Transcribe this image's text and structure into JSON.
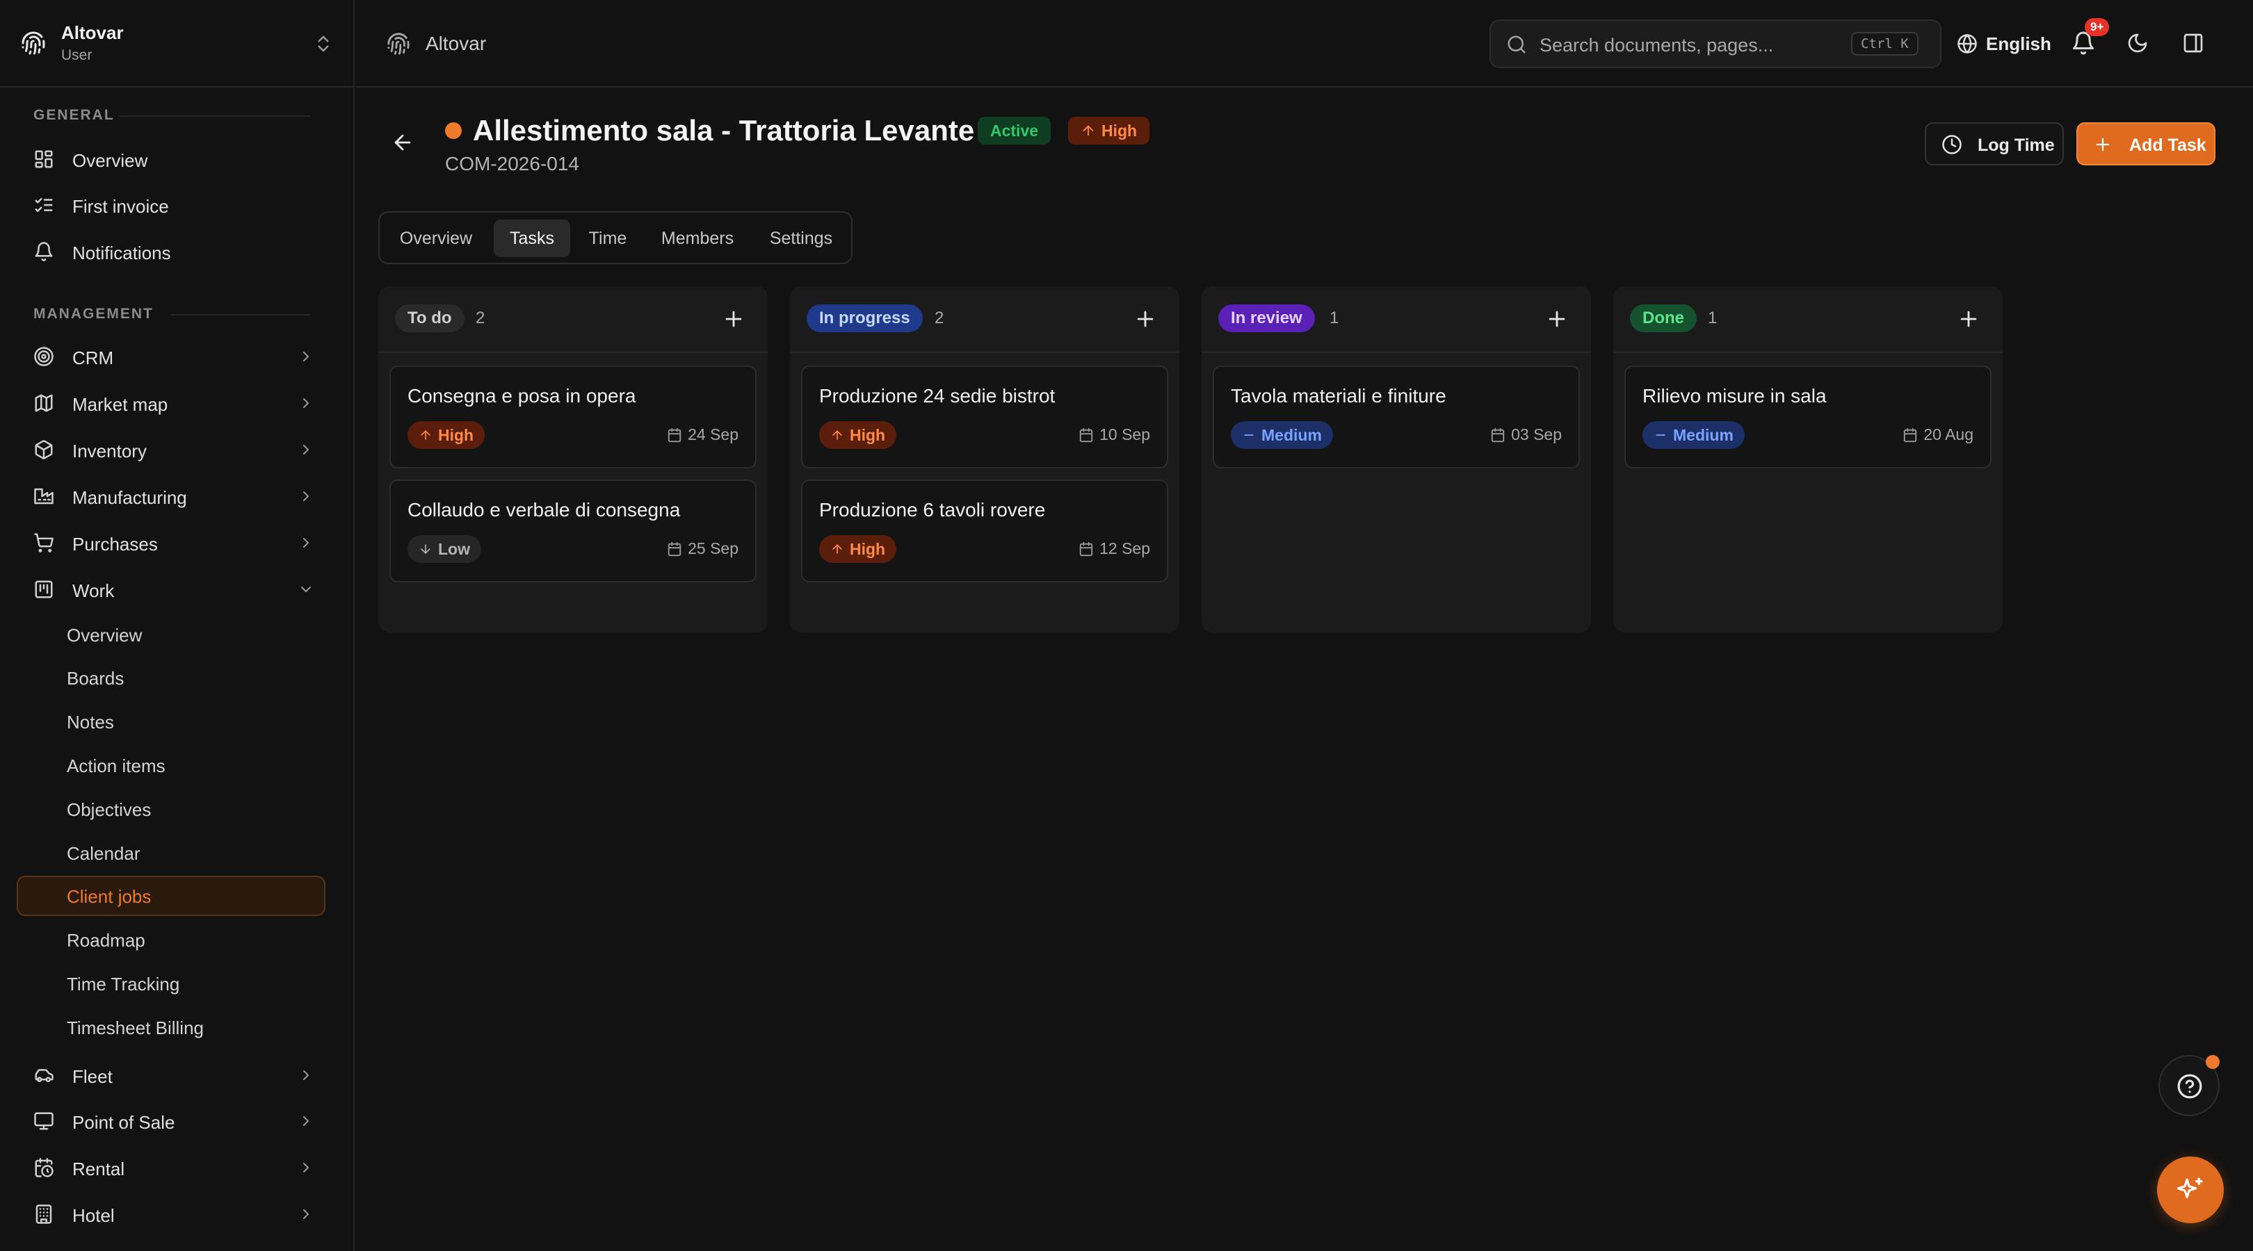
{
  "sidebar": {
    "org_name": "Altovar",
    "org_role": "User",
    "general_label": "GENERAL",
    "management_label": "MANAGEMENT",
    "general_items": [
      {
        "label": "Overview",
        "icon": "dashboard-icon"
      },
      {
        "label": "First invoice",
        "icon": "checklist-icon"
      },
      {
        "label": "Notifications",
        "icon": "bell-icon"
      }
    ],
    "management_items": [
      {
        "label": "CRM",
        "icon": "target-icon"
      },
      {
        "label": "Market map",
        "icon": "map-icon"
      },
      {
        "label": "Inventory",
        "icon": "box-icon"
      },
      {
        "label": "Manufacturing",
        "icon": "factory-icon"
      },
      {
        "label": "Purchases",
        "icon": "cart-icon"
      },
      {
        "label": "Work",
        "icon": "kanban-icon"
      }
    ],
    "work_subitems": [
      {
        "label": "Overview"
      },
      {
        "label": "Boards"
      },
      {
        "label": "Notes"
      },
      {
        "label": "Action items"
      },
      {
        "label": "Objectives"
      },
      {
        "label": "Calendar"
      },
      {
        "label": "Client jobs",
        "active": true
      },
      {
        "label": "Roadmap"
      },
      {
        "label": "Time Tracking"
      },
      {
        "label": "Timesheet Billing"
      }
    ],
    "bottom_items": [
      {
        "label": "Fleet",
        "icon": "car-icon"
      },
      {
        "label": "Point of Sale",
        "icon": "monitor-icon"
      },
      {
        "label": "Rental",
        "icon": "calendar-clock-icon"
      },
      {
        "label": "Hotel",
        "icon": "building-icon"
      }
    ]
  },
  "topbar": {
    "breadcrumb": "Altovar",
    "search_placeholder": "Search documents, pages...",
    "search_shortcut": "Ctrl K",
    "language": "English",
    "notification_badge": "9+"
  },
  "project": {
    "title": "Allestimento sala - Trattoria Levante",
    "status": "Active",
    "priority": "High",
    "code": "COM-2026-014",
    "log_time_label": "Log Time",
    "add_task_label": "Add Task"
  },
  "tabs": [
    {
      "label": "Overview"
    },
    {
      "label": "Tasks",
      "active": true
    },
    {
      "label": "Time"
    },
    {
      "label": "Members"
    },
    {
      "label": "Settings"
    }
  ],
  "board": {
    "columns": [
      {
        "name": "To do",
        "count": "2",
        "cards": [
          {
            "title": "Consegna e posa in opera",
            "priority": "High",
            "date": "24 Sep"
          },
          {
            "title": "Collaudo e verbale di consegna",
            "priority": "Low",
            "date": "25 Sep"
          }
        ]
      },
      {
        "name": "In progress",
        "count": "2",
        "cards": [
          {
            "title": "Produzione 24 sedie bistrot",
            "priority": "High",
            "date": "10 Sep"
          },
          {
            "title": "Produzione 6 tavoli rovere",
            "priority": "High",
            "date": "12 Sep"
          }
        ]
      },
      {
        "name": "In review",
        "count": "1",
        "cards": [
          {
            "title": "Tavola materiali e finiture",
            "priority": "Medium",
            "date": "03 Sep"
          }
        ]
      },
      {
        "name": "Done",
        "count": "1",
        "cards": [
          {
            "title": "Rilievo misure in sala",
            "priority": "Medium",
            "date": "20 Aug"
          }
        ]
      }
    ]
  },
  "colors": {
    "accent": "#e06a1e",
    "status_active": "#35c76a",
    "priority_high": "#ff8a4c",
    "priority_medium": "#7aa2ff",
    "col_todo": "#2a2a2a",
    "col_progress": "#1f3a8a",
    "col_review": "#5b21b6",
    "col_done": "#14532d"
  }
}
